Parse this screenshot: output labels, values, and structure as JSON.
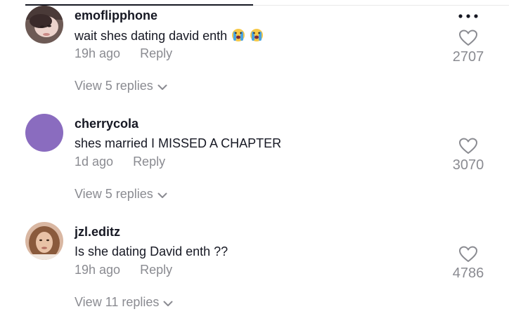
{
  "colors": {
    "text_primary": "#161823",
    "text_secondary": "#8a8b91",
    "avatar_purple": "#8a6cbf"
  },
  "more_icon": "more-horizontal-icon",
  "comments": [
    {
      "username": "emoflipphone",
      "text": "wait shes dating david enth",
      "emojis": [
        "crying-face-emoji",
        "crying-face-emoji"
      ],
      "time": "19h ago",
      "reply_label": "Reply",
      "likes": "2707",
      "view_replies": "View 5 replies",
      "avatar": "photo-avatar"
    },
    {
      "username": "cherrycola",
      "text": "shes married I MISSED A CHAPTER",
      "time": "1d ago",
      "reply_label": "Reply",
      "likes": "3070",
      "view_replies": "View 5 replies",
      "avatar": "purple-solid-avatar"
    },
    {
      "username": "jzl.editz",
      "text": "Is she dating David enth ??",
      "time": "19h ago",
      "reply_label": "Reply",
      "likes": "4786",
      "view_replies": "View 11 replies",
      "avatar": "photo-avatar"
    }
  ]
}
